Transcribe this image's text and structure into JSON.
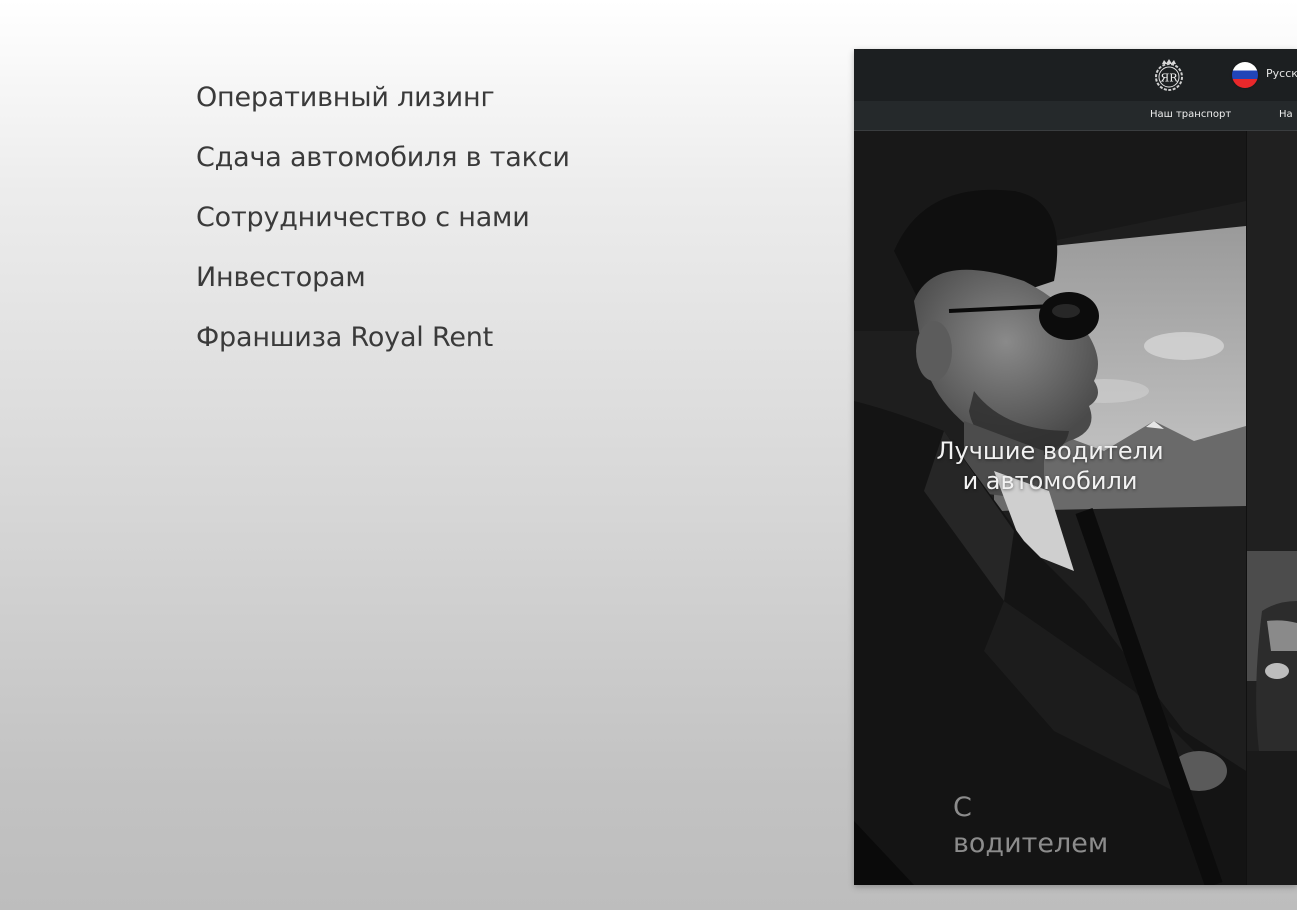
{
  "menu": {
    "items": [
      "Оперативный лизинг",
      "Сдача автомобиля в такси",
      "Сотрудничество с нами",
      "Инвесторам",
      "Франшиза Royal Rent"
    ]
  },
  "preview": {
    "logo_text": "ЯR",
    "language": "Русск",
    "nav": [
      "Наш транспорт",
      "На"
    ],
    "headline": [
      "Лучшие водители",
      "и автомобили"
    ],
    "caption": [
      "С",
      "водителем"
    ]
  },
  "icons": {
    "logo": "crest-logo-icon",
    "flag": "russia-flag-icon"
  },
  "colors": {
    "menu_text": "#3a3a3a",
    "topbar": "#1c1f21",
    "navbar": "#25292b",
    "headline": "#f2f2f2",
    "caption": "#8c8c8c"
  }
}
